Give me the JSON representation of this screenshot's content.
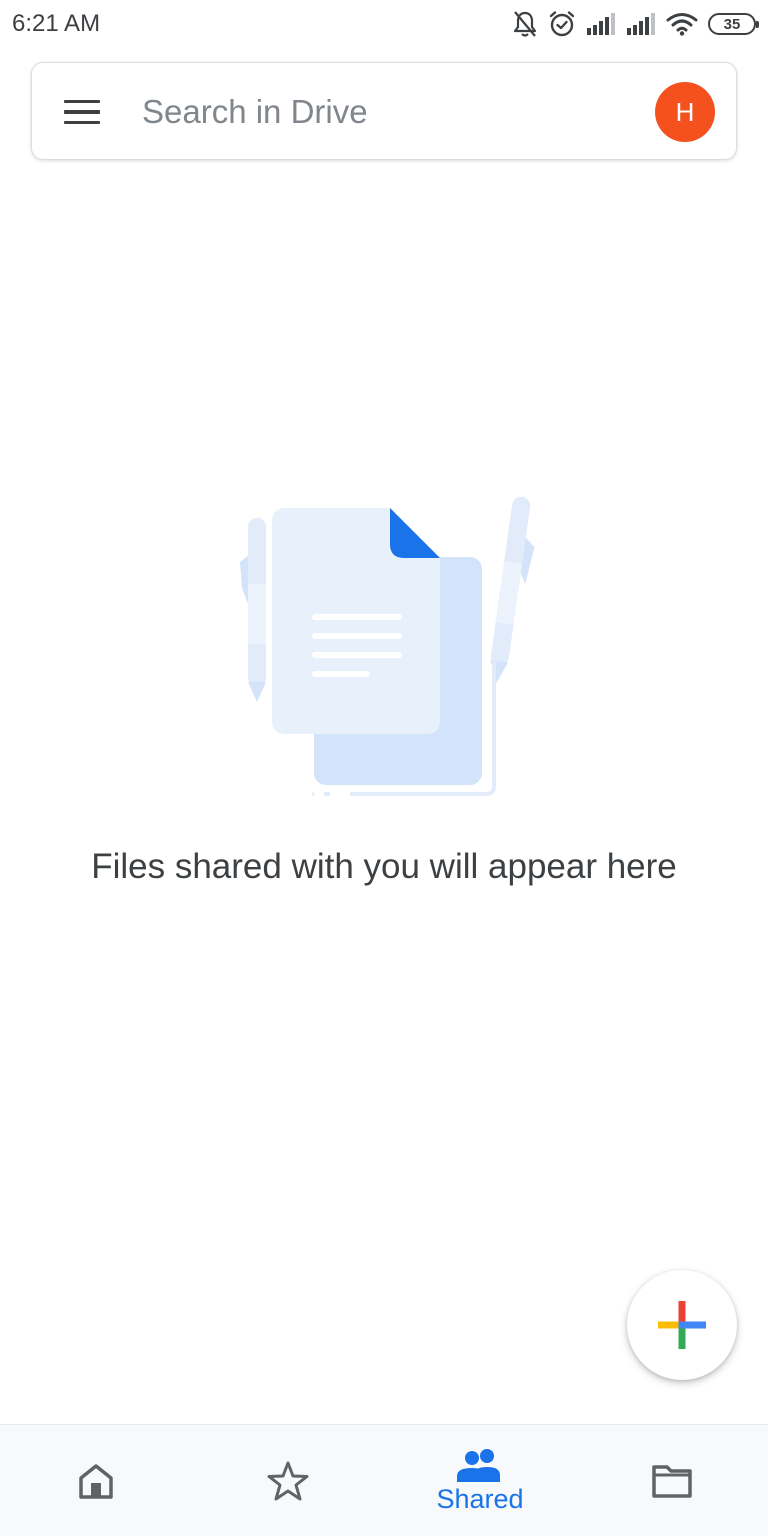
{
  "status_bar": {
    "time": "6:21 AM",
    "battery_level": "35",
    "icons": [
      "bell-off-icon",
      "alarm-icon",
      "signal-icon",
      "signal-icon",
      "wifi-icon",
      "battery-icon"
    ]
  },
  "search": {
    "placeholder": "Search in Drive",
    "value": ""
  },
  "account": {
    "avatar_letter": "H",
    "avatar_color": "#f4511e"
  },
  "empty_state": {
    "message": "Files shared with you will appear here",
    "illustration": "shared-files-illustration"
  },
  "fab": {
    "icon": "multicolor-plus-icon",
    "colors": [
      "#ea4335",
      "#fbbc04",
      "#34a853",
      "#4285f4"
    ]
  },
  "bottom_nav": {
    "items": [
      {
        "id": "home",
        "icon": "home-icon",
        "label": ""
      },
      {
        "id": "starred",
        "icon": "star-icon",
        "label": ""
      },
      {
        "id": "shared",
        "icon": "people-icon",
        "label": "Shared",
        "active": true
      },
      {
        "id": "files",
        "icon": "folder-icon",
        "label": ""
      }
    ],
    "active_color": "#1a73e8",
    "inactive_color": "#5f6368"
  }
}
